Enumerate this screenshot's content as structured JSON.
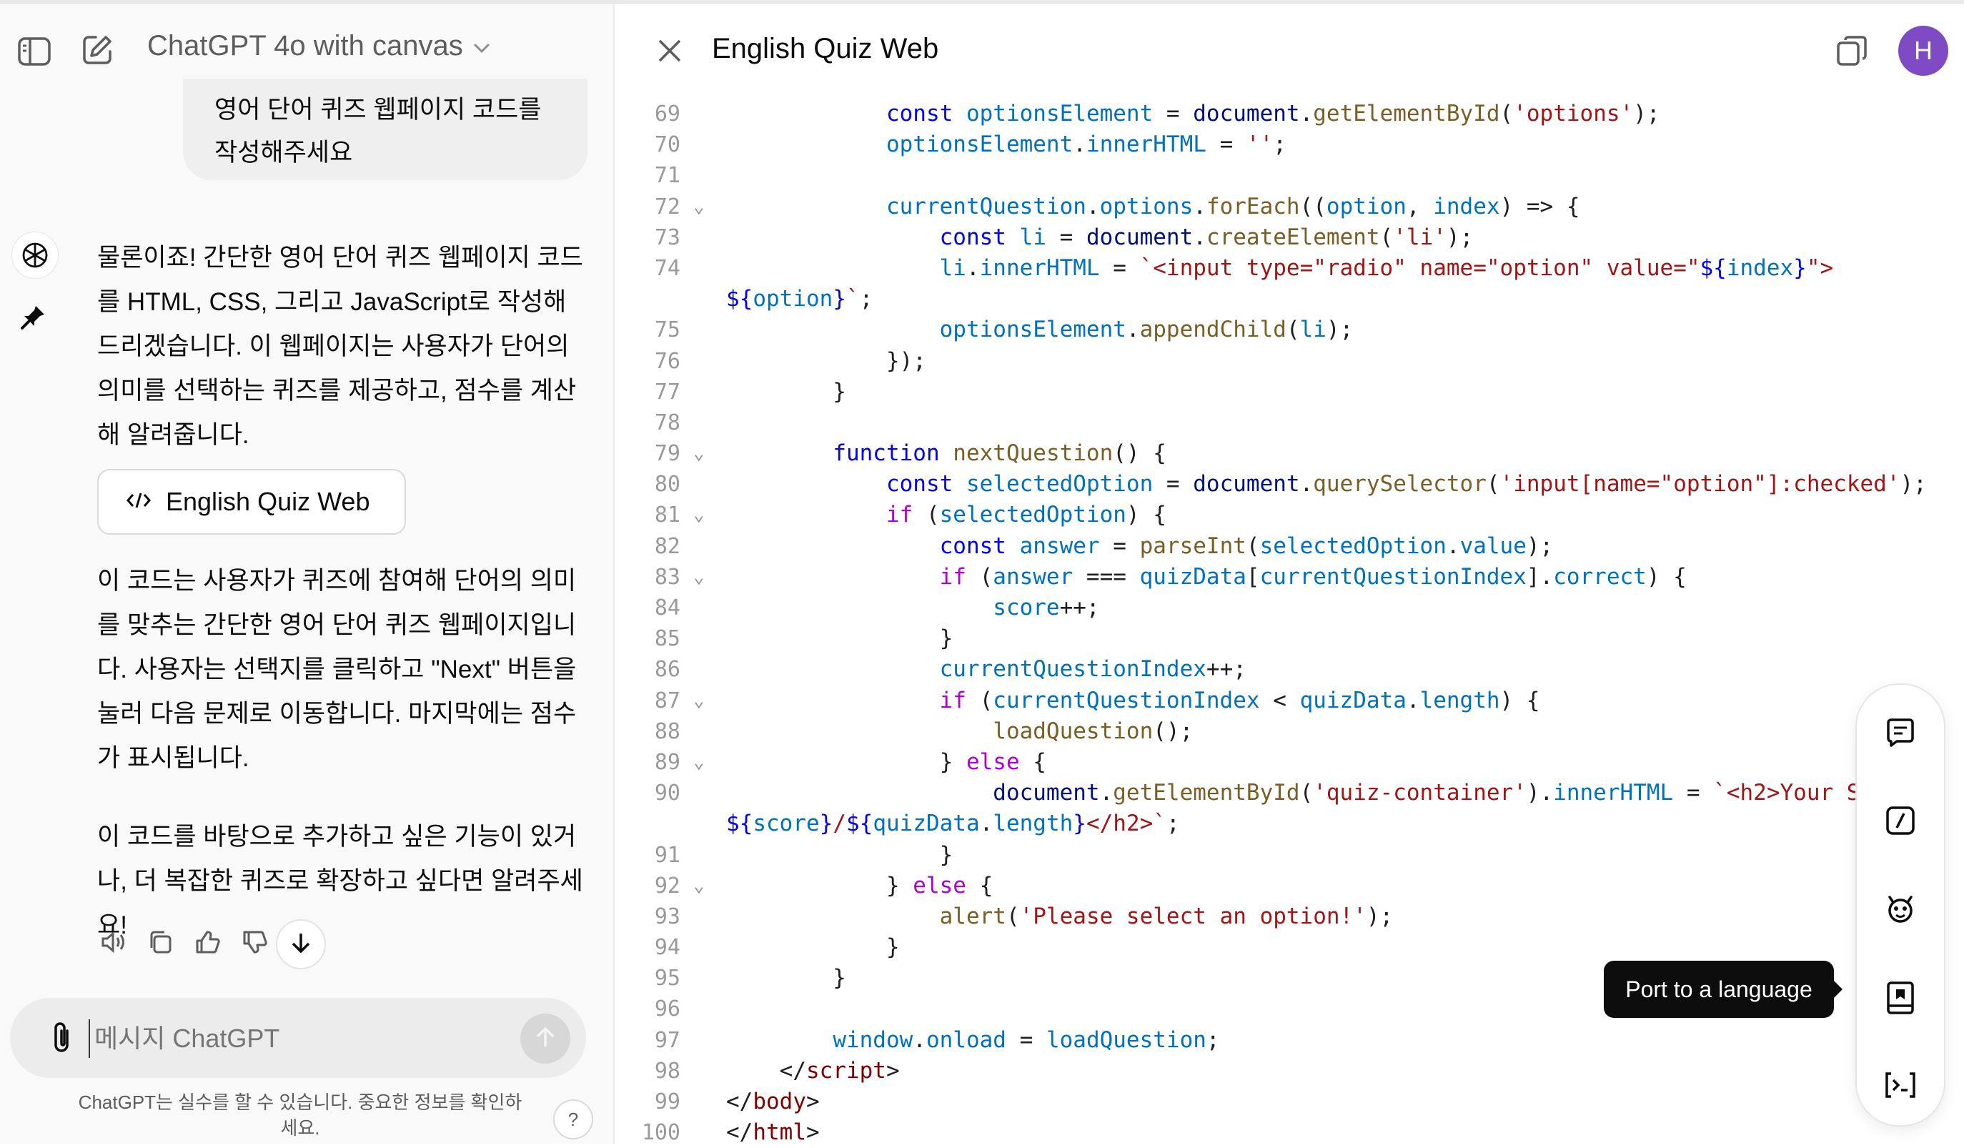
{
  "header": {
    "model_title": "ChatGPT 4o with canvas"
  },
  "chat": {
    "user_message": "영어 단어 퀴즈 웹페이지 코드를 작성해주세요",
    "assistant_intro": "물론이죠! 간단한 영어 단어 퀴즈 웹페이지 코드를 HTML, CSS, 그리고 JavaScript로 작성해 드리겠습니다. 이 웹페이지는 사용자가 단어의 의미를 선택하는 퀴즈를 제공하고, 점수를 계산해 알려줍니다.",
    "canvas_card_label": "English Quiz Web",
    "assistant_explain": "이 코드는 사용자가 퀴즈에 참여해 단어의 의미를 맞추는 간단한 영어 단어 퀴즈 웹페이지입니다. 사용자는 선택지를 클릭하고 \"Next\" 버튼을 눌러 다음 문제로 이동합니다. 마지막에는 점수가 표시됩니다.",
    "assistant_followup": "이 코드를 바탕으로 추가하고 싶은 기능이 있거나, 더 복잡한 퀴즈로 확장하고 싶다면 알려주세요!"
  },
  "composer": {
    "placeholder": "메시지 ChatGPT",
    "disclaimer": "ChatGPT는 실수를 할 수 있습니다. 중요한 정보를 확인하세요.",
    "help_label": "?"
  },
  "editor": {
    "title": "English Quiz Web",
    "avatar_initial": "H",
    "tooltip": "Port to a language"
  },
  "code": {
    "line_numbers": [
      "69",
      "70",
      "71",
      "72",
      "73",
      "74",
      "75",
      "76",
      "77",
      "78",
      "79",
      "80",
      "81",
      "82",
      "83",
      "84",
      "85",
      "86",
      "87",
      "88",
      "89",
      "90",
      "91",
      "92",
      "93",
      "94",
      "95",
      "96",
      "97",
      "98",
      "99",
      "100"
    ]
  },
  "colors": {
    "accent_avatar": "#7e4bc4",
    "keyword": "#0000ff",
    "control": "#af00db",
    "string": "#a31515",
    "function": "#795e26",
    "identifier": "#0070c1"
  },
  "icons": [
    "sidebar-toggle-icon",
    "new-chat-icon",
    "chevron-down-icon",
    "openai-logo-icon",
    "pin-icon",
    "code-icon",
    "speaker-icon",
    "copy-icon",
    "thumbs-up-icon",
    "thumbs-down-icon",
    "arrow-down-icon",
    "paperclip-icon",
    "arrow-up-icon",
    "close-icon",
    "duplicate-icon",
    "comment-icon",
    "slash-box-icon",
    "bug-icon",
    "port-language-icon",
    "console-icon"
  ]
}
